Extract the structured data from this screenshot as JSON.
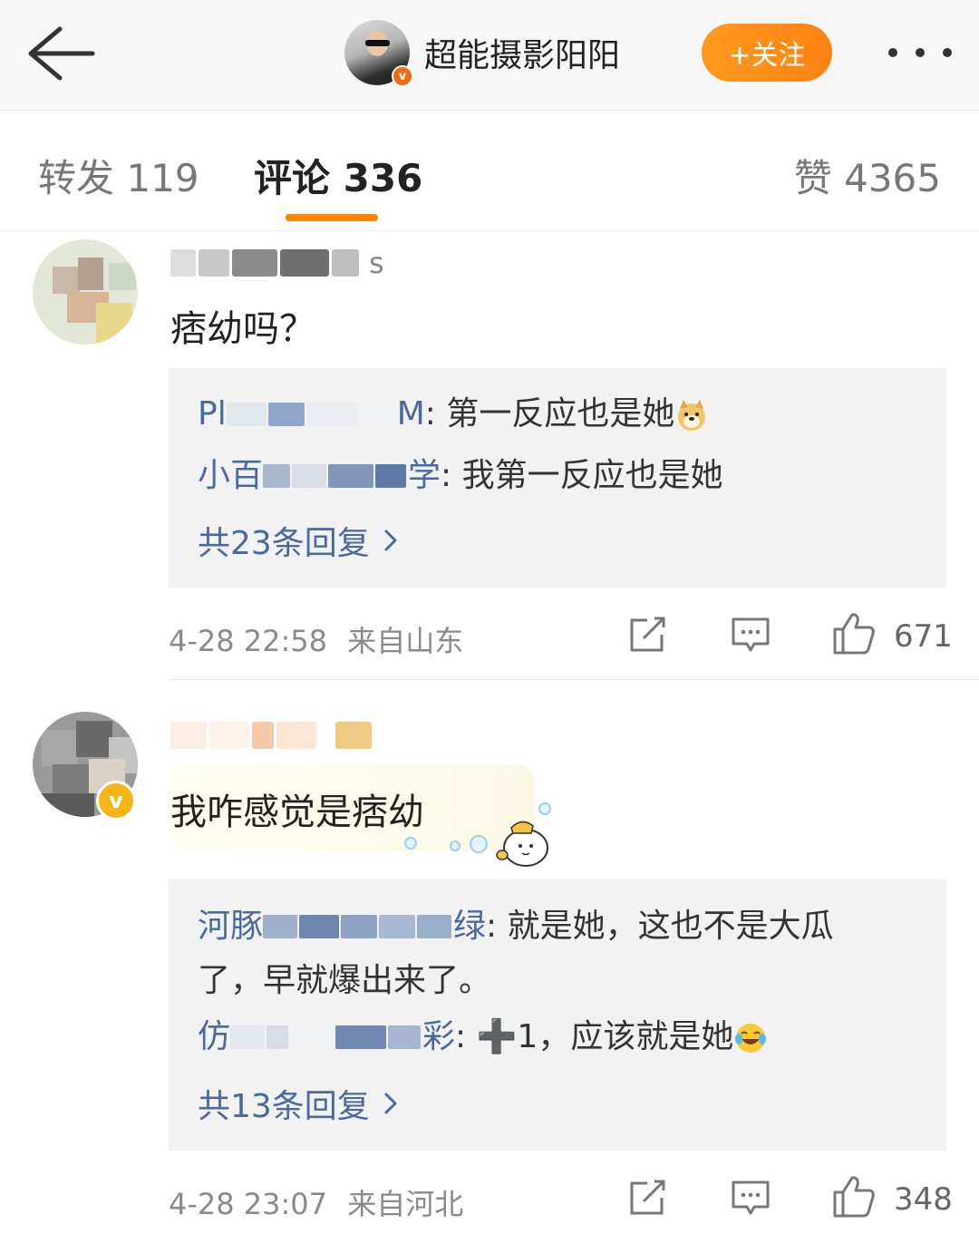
{
  "header": {
    "back_icon": "arrow-left-icon",
    "author_name": "超能摄影阳阳",
    "verified_badge": "v",
    "follow_label": "+关注",
    "more_icon": "more-dots-icon",
    "colors": {
      "follow": "#ff8200",
      "accent_underline": "#ff8200"
    }
  },
  "tabs": {
    "repost": "转发 119",
    "comment": "评论 336",
    "like": "赞 4365"
  },
  "comments": [
    {
      "name_visible_suffix": "s",
      "text": "痞幼吗？",
      "replies": [
        {
          "name_prefix": "Pl",
          "name_suffix": "M",
          "text": ": 第一反应也是她",
          "emoji": "doge-emoji"
        },
        {
          "name_prefix": "小百",
          "name_suffix": "学",
          "text": ": 我第一反应也是她"
        }
      ],
      "more_replies": "共23条回复",
      "time": "4-28 22:58",
      "location": "来自山东",
      "likes": "671"
    },
    {
      "verified_badge": "v",
      "text": "我咋感觉是痞幼",
      "replies": [
        {
          "name_prefix": "河豚",
          "name_suffix": "绿",
          "text": ": 就是她，这也不是大瓜",
          "text2": "了，早就爆出来了。"
        },
        {
          "name_prefix": "仿",
          "name_suffix": "彩",
          "text": ": ➕1，应该就是她",
          "emoji": "laugh-cry-emoji"
        }
      ],
      "more_replies": "共13条回复",
      "time": "4-28 23:07",
      "location": "来自河北",
      "likes": "348"
    }
  ]
}
